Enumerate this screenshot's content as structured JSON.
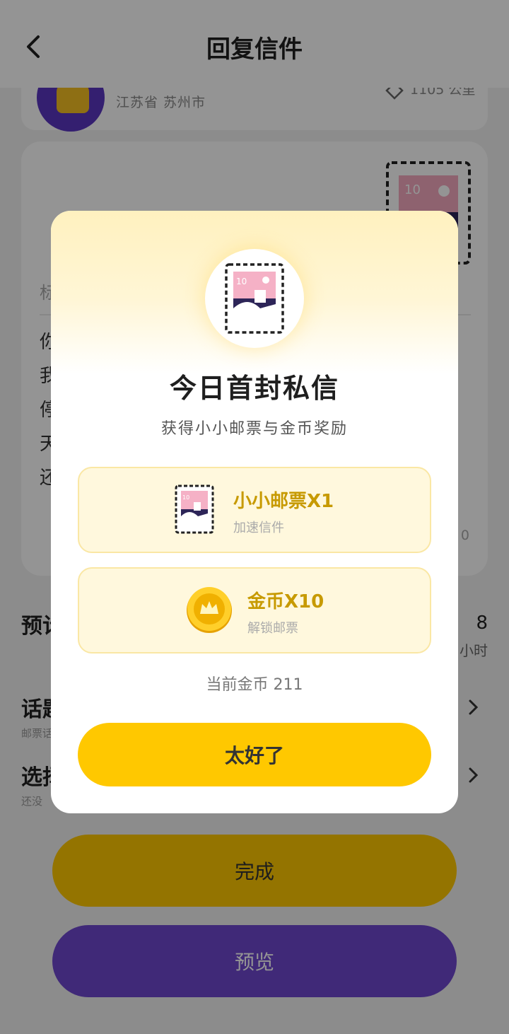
{
  "header": {
    "title": "回复信件"
  },
  "sender": {
    "location": "江苏省 苏州市",
    "distance": "1105 公里"
  },
  "letter": {
    "stamp_value": "10",
    "title_placeholder": "标",
    "body_lines": [
      "你",
      "我",
      "停",
      "天",
      "还"
    ],
    "char_count": "0"
  },
  "rows": {
    "eta_title": "预计",
    "eta_value": "8",
    "eta_unit": "小时",
    "topic_title": "话题",
    "topic_sub": "邮票话",
    "choose_title": "选择",
    "choose_sub": "还没"
  },
  "buttons": {
    "done": "完成",
    "preview": "预览"
  },
  "modal": {
    "title": "今日首封私信",
    "subtitle": "获得小小邮票与金币奖励",
    "rewards": [
      {
        "name": "小小邮票X1",
        "desc": "加速信件",
        "icon": "stamp-icon"
      },
      {
        "name": "金币X10",
        "desc": "解锁邮票",
        "icon": "gold-coin-icon"
      }
    ],
    "current_coins": "当前金币 211",
    "confirm": "太好了"
  },
  "colors": {
    "accent_yellow": "#ffc800",
    "accent_purple": "#6e48cf",
    "reward_text": "#c79a00"
  }
}
